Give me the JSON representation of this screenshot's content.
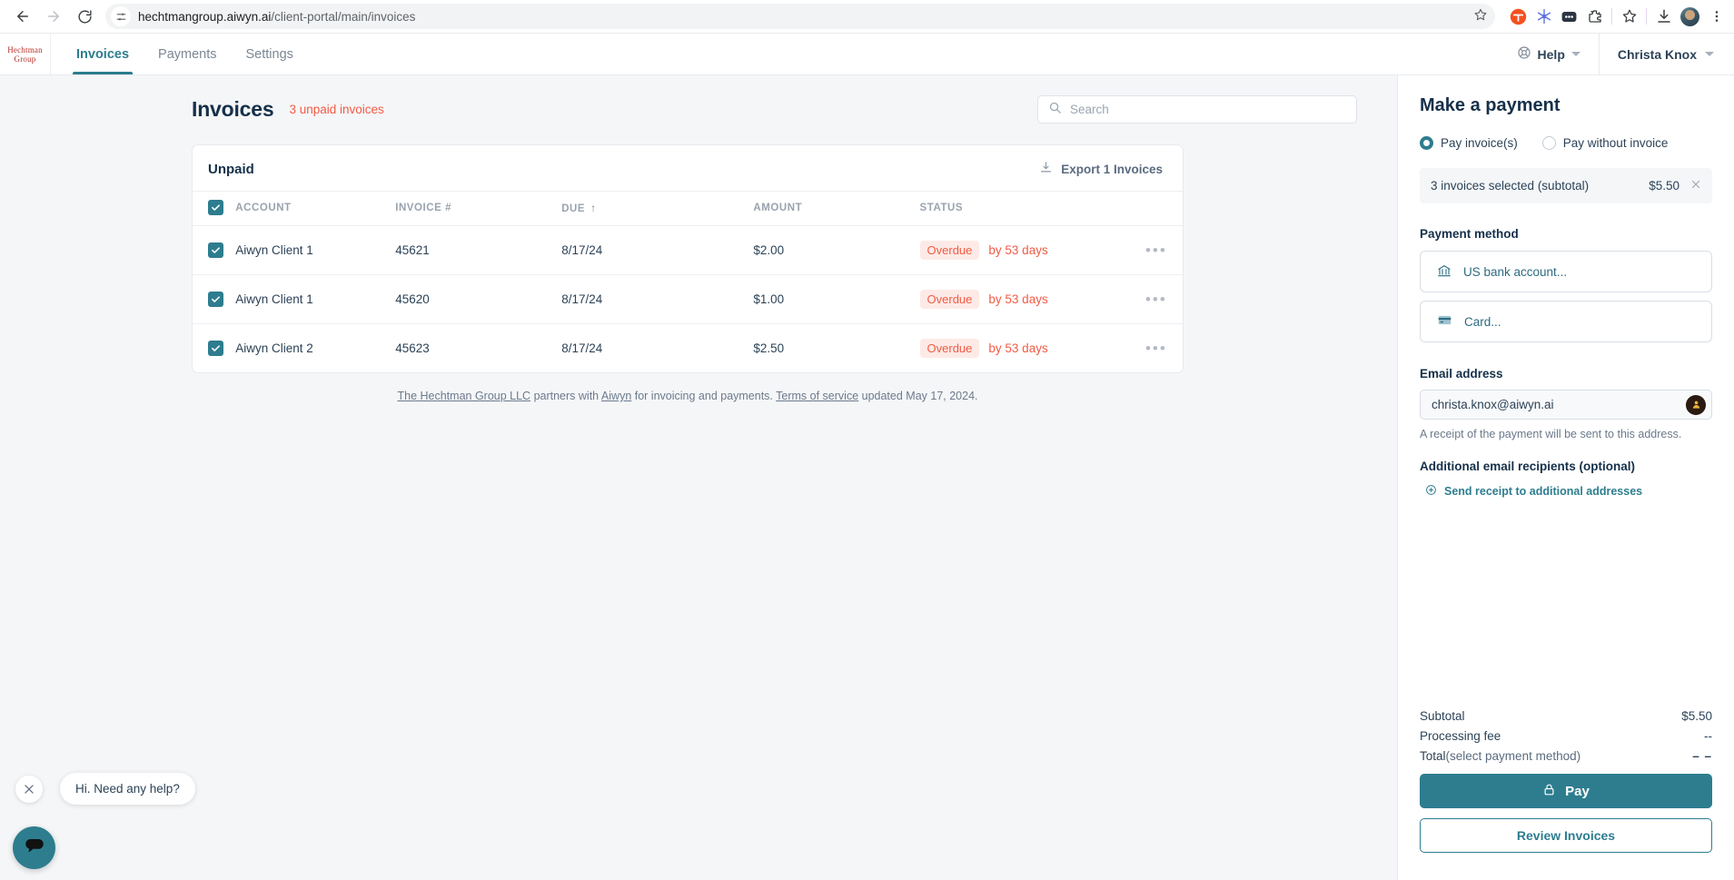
{
  "browser": {
    "back_icon": "back-arrow-icon",
    "forward_icon": "forward-arrow-icon",
    "reload_icon": "reload-icon",
    "site_settings_icon": "site-settings-icon",
    "url_domain": "hechtmangroup.aiwyn.ai",
    "url_path": "/client-portal/main/invoices",
    "bookmark_icon": "star-icon",
    "extensions": [
      "extension-t-icon",
      "extension-snowflake-icon",
      "extension-dots-icon",
      "extension-puzzle-icon",
      "extension-star-icon",
      "downloads-icon",
      "profile-avatar",
      "chrome-menu-icon"
    ]
  },
  "header": {
    "logo_line1": "Hechtman",
    "logo_line2": "Group",
    "tabs": [
      {
        "label": "Invoices",
        "active": true
      },
      {
        "label": "Payments",
        "active": false
      },
      {
        "label": "Settings",
        "active": false
      }
    ],
    "help_label": "Help",
    "user_name": "Christa Knox"
  },
  "main": {
    "page_title": "Invoices",
    "unpaid_count_label": "3 unpaid invoices",
    "search_placeholder": "Search",
    "search_value": "",
    "card_title": "Unpaid",
    "export_label": "Export 1 Invoices",
    "columns": [
      "ACCOUNT",
      "INVOICE #",
      "DUE",
      "AMOUNT",
      "STATUS"
    ],
    "sort_column": "DUE",
    "sort_arrow": "↑",
    "rows": [
      {
        "checked": true,
        "account": "Aiwyn Client 1",
        "invoice": "45621",
        "due": "8/17/24",
        "amount": "$2.00",
        "status": "Overdue",
        "status_detail": "by 53 days"
      },
      {
        "checked": true,
        "account": "Aiwyn Client 1",
        "invoice": "45620",
        "due": "8/17/24",
        "amount": "$1.00",
        "status": "Overdue",
        "status_detail": "by 53 days"
      },
      {
        "checked": true,
        "account": "Aiwyn Client 2",
        "invoice": "45623",
        "due": "8/17/24",
        "amount": "$2.50",
        "status": "Overdue",
        "status_detail": "by 53 days"
      }
    ],
    "footnote": {
      "firm": "The Hechtman Group LLC",
      "mid1": " partners with ",
      "partner": "Aiwyn",
      "mid2": " for invoicing and payments. ",
      "terms": "Terms of service",
      "mid3": " updated May 17, 2024."
    }
  },
  "payment_panel": {
    "title": "Make a payment",
    "mode_options": [
      {
        "label": "Pay invoice(s)",
        "selected": true
      },
      {
        "label": "Pay without invoice",
        "selected": false
      }
    ],
    "selection_label": "3 invoices selected (subtotal)",
    "selection_amount": "$5.50",
    "payment_method_label": "Payment method",
    "methods": [
      {
        "label": "US bank account...",
        "icon": "bank-icon"
      },
      {
        "label": "Card...",
        "icon": "credit-card-icon"
      }
    ],
    "email_label": "Email address",
    "email_value": "christa.knox@aiwyn.ai",
    "email_hint": "A receipt of the payment will be sent to this address.",
    "additional_label": "Additional email recipients (optional)",
    "send_receipt_label": "Send receipt to additional addresses",
    "totals": [
      {
        "label": "Subtotal",
        "value": "$5.50"
      },
      {
        "label": "Processing fee",
        "value": "--"
      },
      {
        "label": "Total",
        "sub": " (select payment method)",
        "value": "– –"
      }
    ],
    "pay_label": "Pay",
    "review_label": "Review Invoices"
  },
  "chat": {
    "message": "Hi. Need any help?",
    "close_icon": "close-icon",
    "fab_icon": "chat-bubble-icon"
  },
  "colors": {
    "accent_teal": "#2d7d8f",
    "overdue_red": "#f15b45",
    "overdue_bg": "#fdeae6",
    "logo_red": "#b8322c",
    "page_bg": "#f5f6f8"
  }
}
